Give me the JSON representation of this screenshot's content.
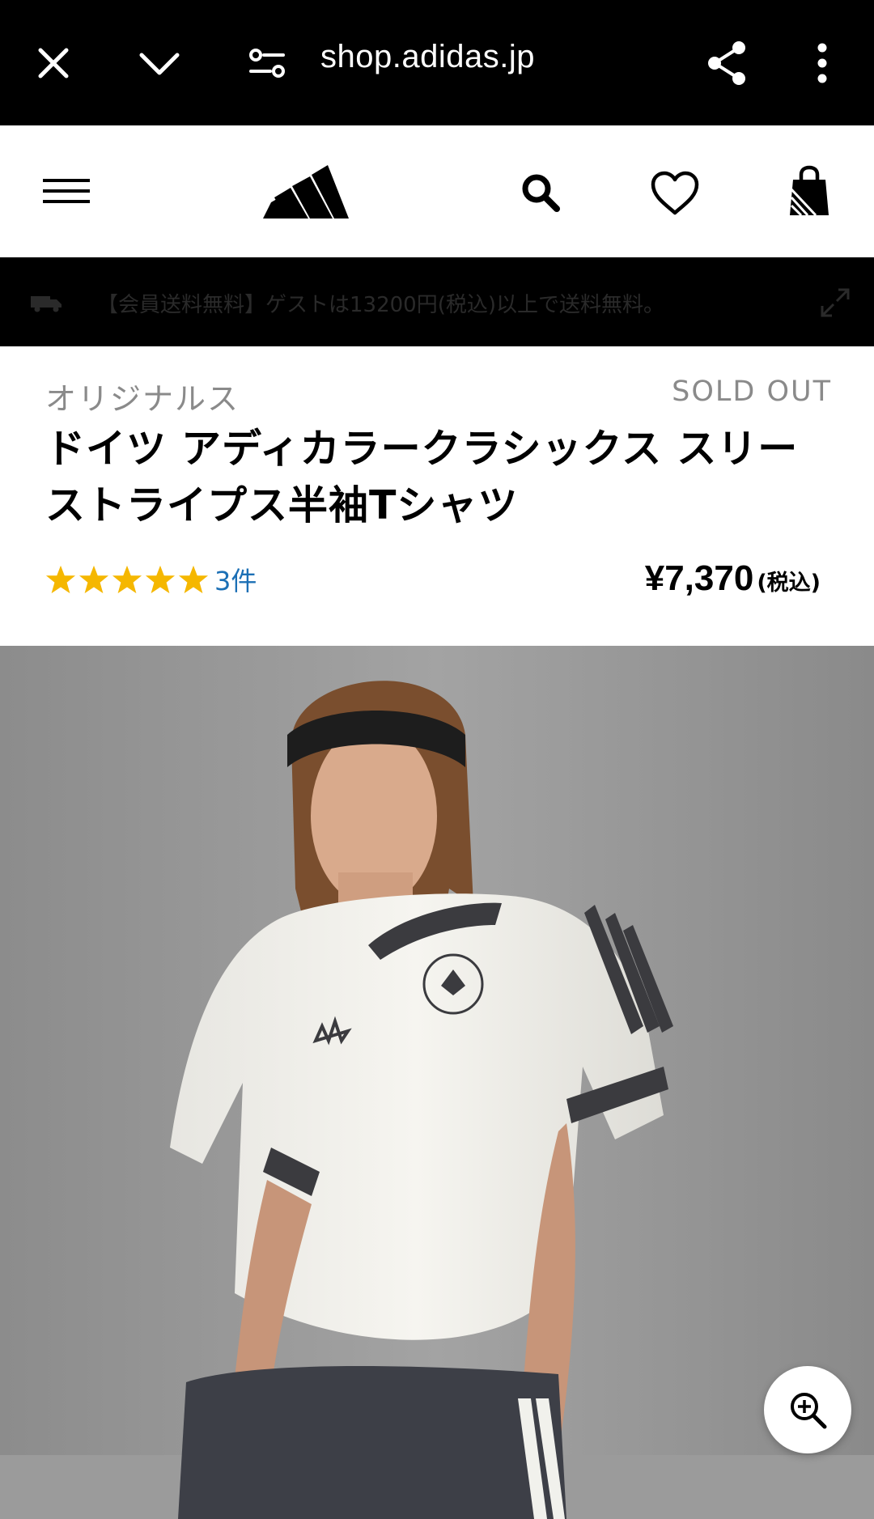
{
  "browser": {
    "url": "shop.adidas.jp",
    "icons": [
      "close-icon",
      "chevron-down-icon",
      "site-settings-icon",
      "share-icon",
      "more-icon"
    ]
  },
  "header": {
    "icons": [
      "menu-icon",
      "adidas-logo",
      "search-icon",
      "heart-icon",
      "bag-icon"
    ]
  },
  "promo": {
    "text": "【会員送料無料】ゲストは13200円(税込)以上で送料無料。"
  },
  "product": {
    "brand": "オリジナルス",
    "status": "SOLD OUT",
    "title": "ドイツ アディカラークラシックス スリーストライプス半袖Tシャツ",
    "rating_stars": 5,
    "review_count": "3件",
    "price": "¥7,370",
    "price_tax": "(税込)"
  },
  "colors": {
    "browser_bar": "#000000",
    "star": "#f5b700",
    "review_link": "#1b6fb5",
    "muted_text": "#8a8a8a"
  }
}
